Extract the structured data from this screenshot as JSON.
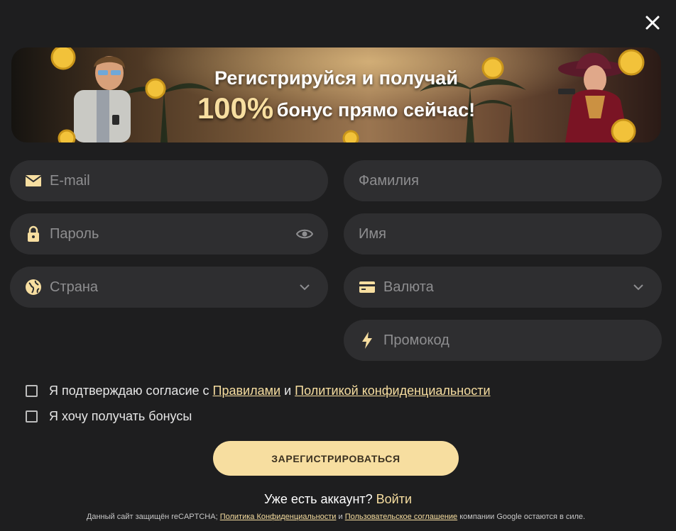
{
  "banner": {
    "line1": "Регистрируйся и получай",
    "percent": "100%",
    "line2_rest": "бонус прямо сейчас!"
  },
  "form": {
    "email": {
      "placeholder": "E-mail",
      "icon": "envelope-icon"
    },
    "surname": {
      "placeholder": "Фамилия"
    },
    "password": {
      "placeholder": "Пароль",
      "icon": "lock-icon",
      "toggle_icon": "eye-icon"
    },
    "name": {
      "placeholder": "Имя"
    },
    "country": {
      "placeholder": "Страна",
      "icon": "globe-icon",
      "dropdown_icon": "chevron-down-icon"
    },
    "currency": {
      "placeholder": "Валюта",
      "icon": "card-icon",
      "dropdown_icon": "chevron-down-icon"
    },
    "promo": {
      "placeholder": "Промокод",
      "icon": "lightning-icon"
    }
  },
  "consent": {
    "prefix": "Я подтверждаю согласие с",
    "rules_link": "Правилами",
    "and": "и",
    "privacy_link": "Политикой конфиденциальности",
    "checked": false
  },
  "bonus_opt": {
    "label": "Я хочу получать бонусы",
    "checked": false
  },
  "submit_label": "ЗАРЕГИСТРИРОВАТЬСЯ",
  "login_prompt": {
    "text": "Уже есть аккаунт?",
    "link": "Войти"
  },
  "recaptcha": {
    "prefix": "Данный сайт защищён reCAPTCHA;",
    "privacy_link": "Политика Конфиденциальности",
    "and": "и",
    "terms_link": "Пользовательское соглашение",
    "suffix": "компании Google остаются в силе."
  },
  "colors": {
    "background": "#1e1e1f",
    "field": "#2e2e30",
    "accent": "#f7dea0",
    "placeholder": "#8e8e90"
  }
}
